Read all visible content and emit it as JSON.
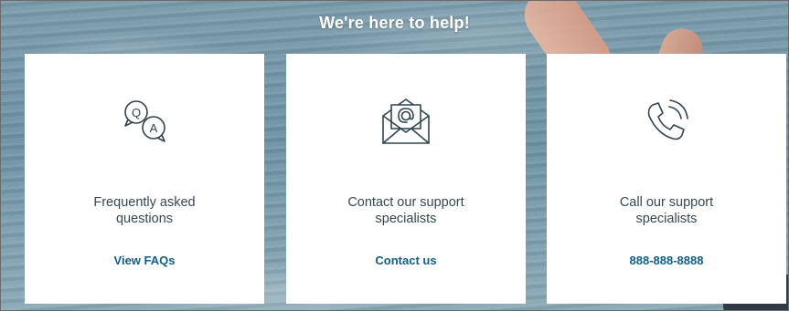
{
  "heading": "We're here to help!",
  "cards": [
    {
      "icon": "faq-chat-bubbles-icon",
      "title": "Frequently asked questions",
      "link": "View FAQs"
    },
    {
      "icon": "email-envelope-icon",
      "title": "Contact our support specialists",
      "link": "Contact us"
    },
    {
      "icon": "phone-icon",
      "title": "Call our support specialists",
      "link": "888-888-8888"
    }
  ],
  "colors": {
    "link": "#0f5e8a",
    "text": "#37474f",
    "icon_stroke": "#2f4451",
    "card_bg": "#ffffff"
  }
}
